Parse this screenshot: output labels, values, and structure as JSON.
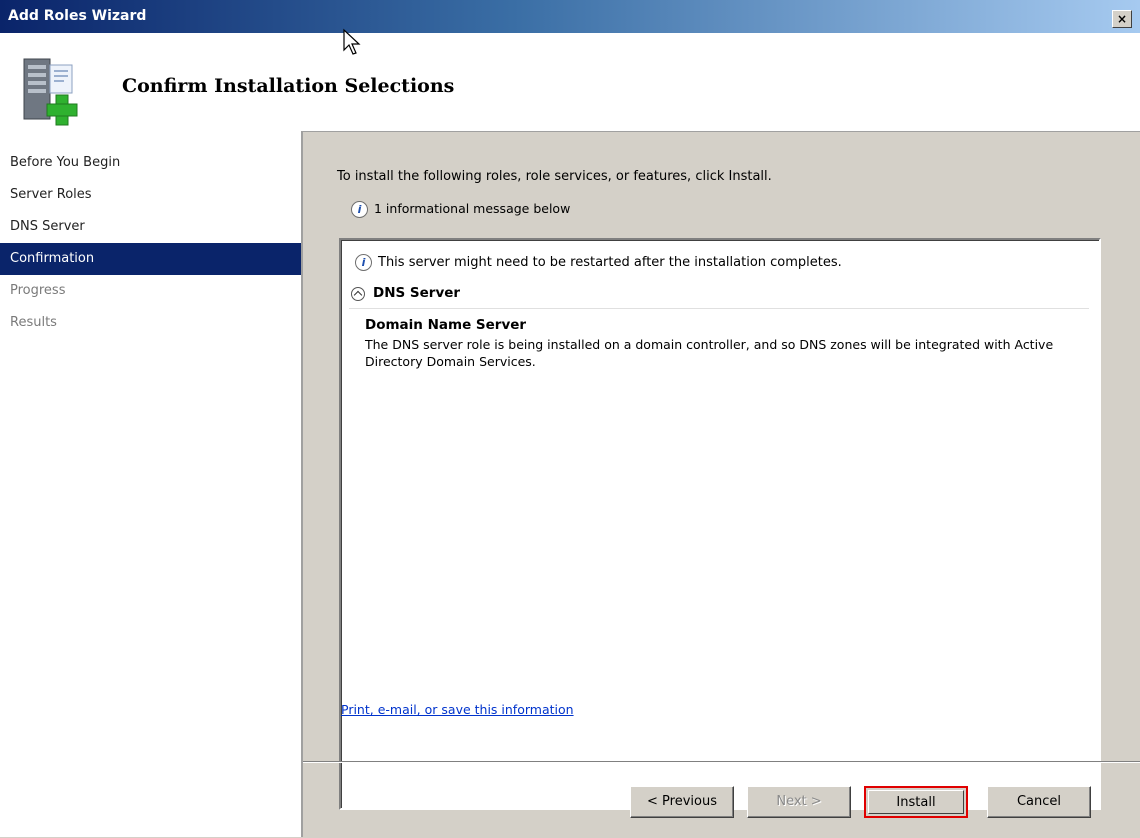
{
  "window": {
    "title": "Add Roles Wizard",
    "close_label": "×"
  },
  "header": {
    "heading": "Confirm Installation Selections"
  },
  "sidebar": {
    "items": [
      {
        "label": "Before You Begin",
        "state": "normal"
      },
      {
        "label": "Server Roles",
        "state": "normal"
      },
      {
        "label": "DNS Server",
        "state": "normal"
      },
      {
        "label": "Confirmation",
        "state": "active"
      },
      {
        "label": "Progress",
        "state": "disabled"
      },
      {
        "label": "Results",
        "state": "disabled"
      }
    ]
  },
  "content": {
    "instruction": "To install the following roles, role services, or features, click Install.",
    "info_summary": "1 informational message below",
    "panel": {
      "message": "This server might need to be restarted after the installation completes.",
      "section_title": "DNS Server",
      "role_name": "Domain Name Server",
      "role_description": "The DNS server role is being installed on a domain controller, and so DNS zones will be integrated with Active Directory Domain Services."
    },
    "link_text": "Print, e-mail, or save this information"
  },
  "buttons": {
    "previous": "< Previous",
    "next": "Next >",
    "install": "Install",
    "cancel": "Cancel"
  },
  "icons": {
    "info": "i",
    "header": "server-add-icon"
  },
  "colors": {
    "active_nav": "#0a246a",
    "highlight_border": "#e00000",
    "link": "#0033cc"
  }
}
